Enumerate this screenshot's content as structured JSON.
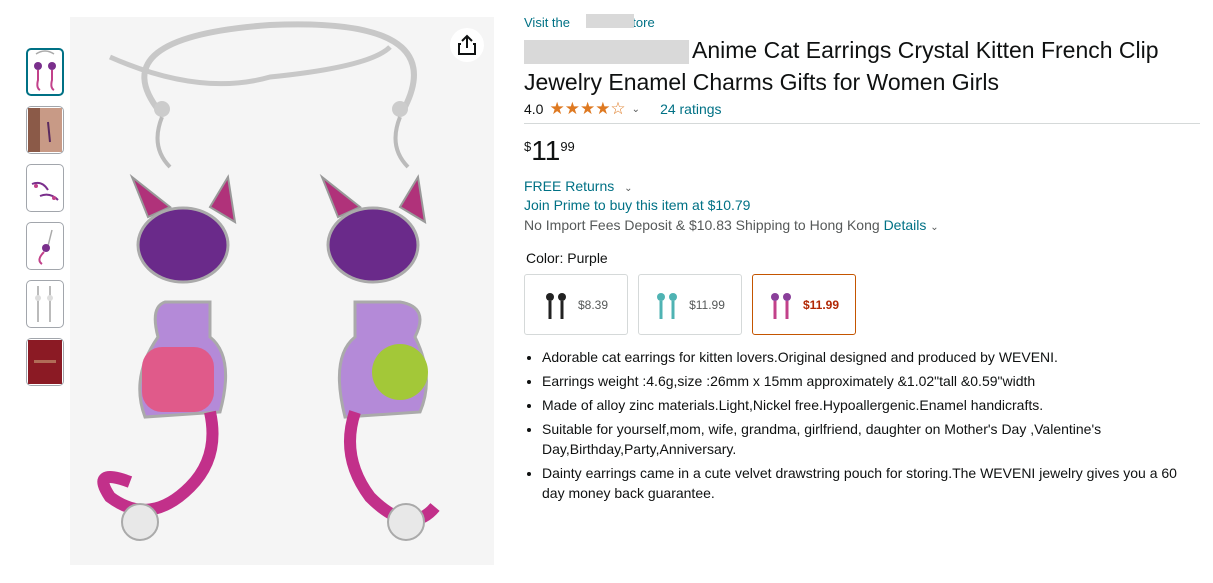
{
  "thumbnails": [
    {
      "name": "thumb-1",
      "active": true
    },
    {
      "name": "thumb-2",
      "active": false
    },
    {
      "name": "thumb-3",
      "active": false
    },
    {
      "name": "thumb-4",
      "active": false
    },
    {
      "name": "thumb-5",
      "active": false
    },
    {
      "name": "thumb-6",
      "active": false
    }
  ],
  "store_link": "Visit the",
  "store_link_suffix": "Store",
  "title": "Anime Cat Earrings Crystal Kitten French Clip Jewelry Enamel Charms Gifts for Women Girls",
  "rating": {
    "value": "4.0",
    "stars_text": "★★★★☆",
    "dropdown_icon": "chevron-down-icon",
    "count_label": "24 ratings"
  },
  "price": {
    "symbol": "$",
    "whole": "11",
    "fraction": "99"
  },
  "returns_label": "FREE Returns",
  "prime_offer": "Join Prime to buy this item at $10.79",
  "import_fees": "No Import Fees Deposit & $10.83 Shipping to Hong Kong",
  "details_link": "Details",
  "color": {
    "label": "Color:",
    "value": "Purple"
  },
  "swatches": [
    {
      "price": "$8.39",
      "selected": false,
      "color": "#222222"
    },
    {
      "price": "$11.99",
      "selected": false,
      "color": "#4fb3b3"
    },
    {
      "price": "$11.99",
      "selected": true,
      "color": "#8a3f9a"
    }
  ],
  "bullets": [
    "Adorable cat earrings for kitten lovers.Original designed and produced by WEVENI.",
    "Earrings weight :4.6g,size :26mm x 15mm approximately &1.02\"tall &0.59\"width",
    "Made of alloy zinc materials.Light,Nickel free.Hypoallergenic.Enamel handicrafts.",
    "Suitable for yourself,mom, wife, grandma, girlfriend, daughter on Mother's Day ,Valentine's Day,Birthday,Party,Anniversary.",
    "Dainty earrings came in a cute velvet drawstring pouch for storing.The WEVENI jewelry gives you a 60 day money back guarantee."
  ],
  "colors": {
    "link": "#007185",
    "star": "#de7921",
    "price_red": "#b12704",
    "selected_border": "#c45500"
  }
}
